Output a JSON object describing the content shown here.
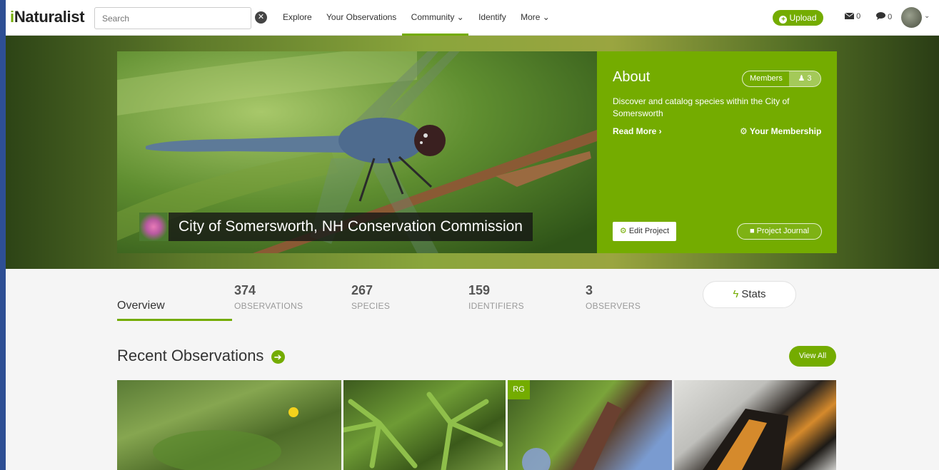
{
  "nav": {
    "logo_i": "i",
    "logo_rest": "Naturalist",
    "search_placeholder": "Search",
    "links": [
      "Explore",
      "Your Observations",
      "Community ⌄",
      "Identify",
      "More ⌄"
    ],
    "upload": "Upload",
    "messages_count": "0",
    "notifications_count": "0"
  },
  "project": {
    "title": "City of Somersworth, NH Conservation Commission",
    "about_heading": "About",
    "members_label": "Members",
    "members_count": "3",
    "description": "Discover and catalog species within the City of Somersworth",
    "read_more": "Read More ›",
    "your_membership": "Your Membership",
    "edit_project": "Edit Project",
    "project_journal": "Project Journal"
  },
  "stats": {
    "overview": "Overview",
    "items": [
      {
        "num": "374",
        "label": "OBSERVATIONS"
      },
      {
        "num": "267",
        "label": "SPECIES"
      },
      {
        "num": "159",
        "label": "IDENTIFIERS"
      },
      {
        "num": "3",
        "label": "OBSERVERS"
      }
    ],
    "stats_button": "Stats"
  },
  "recent": {
    "title": "Recent Observations",
    "view_all": "View All",
    "rg_badge": "RG"
  },
  "colors": {
    "brand_green": "#74ac00",
    "page_bg": "#f5f5f5"
  }
}
